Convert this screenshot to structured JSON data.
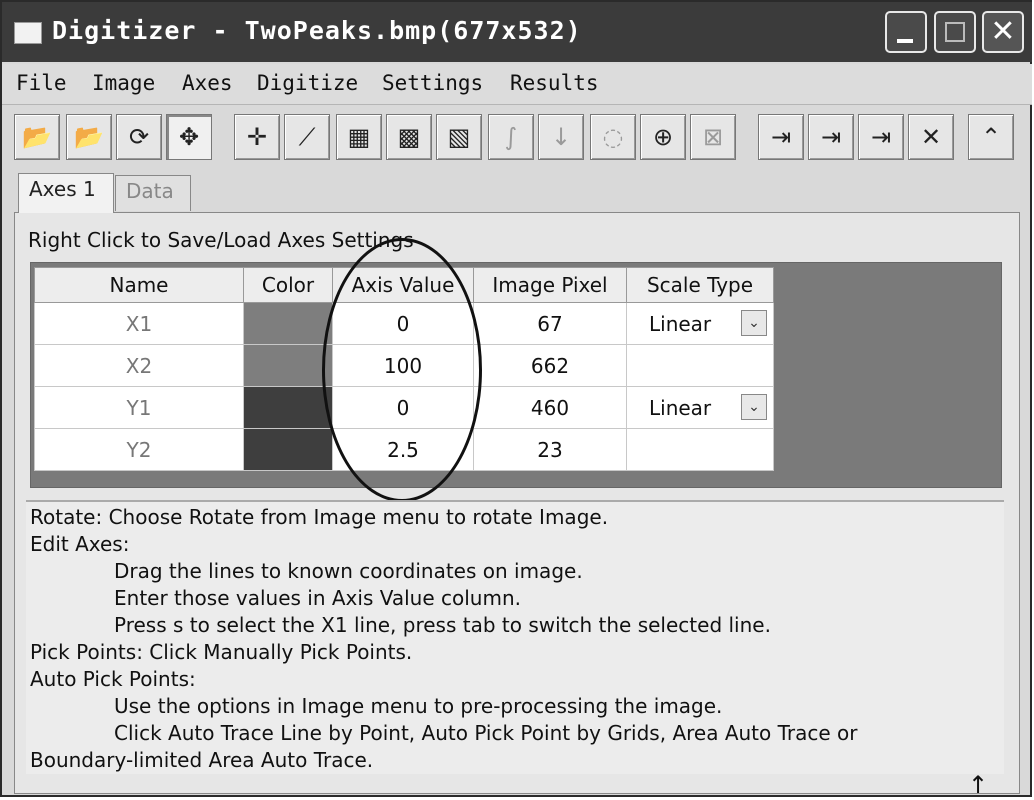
{
  "window": {
    "title": "Digitizer - TwoPeaks.bmp(677x532)",
    "close_glyph": "✕"
  },
  "menu": [
    "File",
    "Image",
    "Axes",
    "Digitize",
    "Settings",
    "Results"
  ],
  "toolbar": [
    {
      "icon": "open-folder-icon",
      "glyph": "📂"
    },
    {
      "icon": "open-folder-2-icon",
      "glyph": "📂"
    },
    {
      "icon": "rotate-icon",
      "glyph": "⟳"
    },
    {
      "icon": "move-axes-icon",
      "glyph": "✥"
    },
    {
      "icon": "manual-pick-icon",
      "glyph": "✛"
    },
    {
      "icon": "auto-trace-icon",
      "glyph": "⟋"
    },
    {
      "icon": "grid-pick-icon",
      "glyph": "▦"
    },
    {
      "icon": "area-trace-icon",
      "glyph": "▩"
    },
    {
      "icon": "boundary-trace-icon",
      "glyph": "▧"
    },
    {
      "icon": "curve-icon",
      "glyph": "∫"
    },
    {
      "icon": "sort-icon",
      "glyph": "↓"
    },
    {
      "icon": "tag-icon",
      "glyph": "◌"
    },
    {
      "icon": "add-point-icon",
      "glyph": "⊕"
    },
    {
      "icon": "delete-grid-icon",
      "glyph": "⊠"
    },
    {
      "icon": "export-table-icon",
      "glyph": "⇥"
    },
    {
      "icon": "export-chart-icon",
      "glyph": "⇥"
    },
    {
      "icon": "export-peaks-icon",
      "glyph": "⇥"
    },
    {
      "icon": "delete-icon",
      "glyph": "✕"
    },
    {
      "icon": "collapse-icon",
      "glyph": "⌃"
    }
  ],
  "tabs": [
    "Axes 1",
    "Data"
  ],
  "hint": "Right Click to Save/Load Axes Settings",
  "table": {
    "headers": [
      "Name",
      "Color",
      "Axis Value",
      "Image Pixel",
      "Scale Type"
    ],
    "rows": [
      {
        "name": "X1",
        "color": "#7e7e7e",
        "axis_value": "0",
        "image_pixel": "67",
        "scale_type": "Linear"
      },
      {
        "name": "X2",
        "color": "#7e7e7e",
        "axis_value": "100",
        "image_pixel": "662",
        "scale_type": ""
      },
      {
        "name": "Y1",
        "color": "#3e3e3e",
        "axis_value": "0",
        "image_pixel": "460",
        "scale_type": "Linear"
      },
      {
        "name": "Y2",
        "color": "#3e3e3e",
        "axis_value": "2.5",
        "image_pixel": "23",
        "scale_type": ""
      }
    ],
    "dropdown_glyph": "⌄"
  },
  "help": [
    "Rotate: Choose Rotate from Image menu to rotate Image.",
    "Edit Axes:",
    "Drag the lines to known coordinates on image.",
    "Enter those values in Axis Value column.",
    "Press s to select the X1 line, press tab to switch the selected line.",
    "Pick Points: Click Manually Pick Points.",
    "Auto Pick Points:",
    "Use the options in Image menu to pre-processing the image.",
    "Click Auto Trace Line by Point, Auto Pick Point by Grids, Area Auto Trace or",
    "Boundary-limited Area Auto Trace."
  ],
  "cursor_glyph": "↑"
}
